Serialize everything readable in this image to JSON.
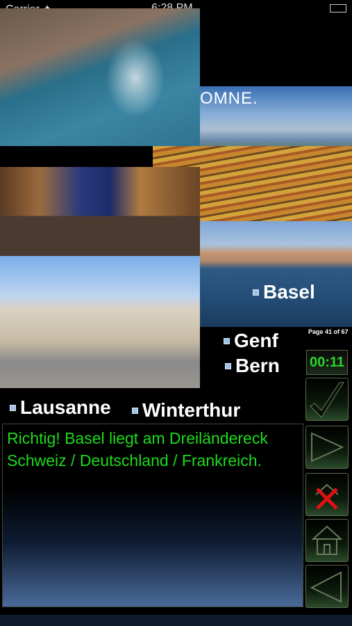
{
  "status_bar": {
    "carrier": "Carrier ✦",
    "time": "6:28 PM"
  },
  "photos": {
    "lake_caption": "OMNE."
  },
  "options": {
    "basel": "Basel",
    "genf": "Genf",
    "bern": "Bern",
    "lausanne": "Lausanne",
    "winterthur": "Winterthur"
  },
  "page_indicator": "Page 41 of 67",
  "timer": "00:11",
  "controls": {
    "check_icon": "checkmark-icon",
    "next_icon": "play-next-icon",
    "exit_icon": "exit-x-icon",
    "home_icon": "home-icon",
    "back_icon": "back-triangle-icon"
  },
  "message": "Richtig! Basel liegt am Dreiländereck Schweiz / Deutschland / Frankreich.",
  "colors": {
    "message_text": "#1bdc1b",
    "timer_text": "#2bd52b",
    "exit_red": "#e01010"
  }
}
